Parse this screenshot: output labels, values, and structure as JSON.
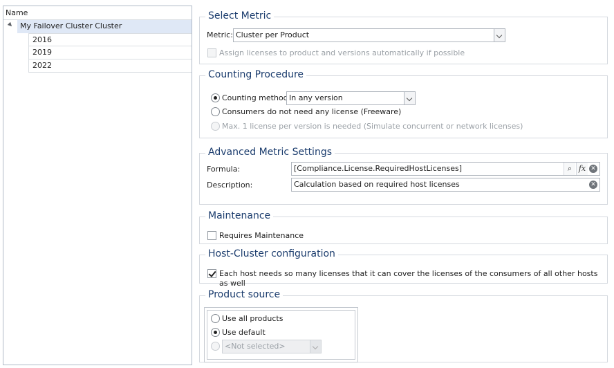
{
  "tree": {
    "header": "Name",
    "root": "My Failover Cluster Cluster",
    "children": [
      "2016",
      "2019",
      "2022"
    ]
  },
  "select_metric": {
    "title": "Select Metric",
    "metric_label": "Metric:",
    "metric_value": "Cluster per Product",
    "assign_label": "Assign licenses to product and versions automatically if possible"
  },
  "counting": {
    "title": "Counting Procedure",
    "method_label": "Counting method",
    "method_value": "In any version",
    "freeware_label": "Consumers do not need any license (Freeware)",
    "max_label": "Max. 1 license per version is needed (Simulate concurrent or network licenses)"
  },
  "advanced": {
    "title": "Advanced Metric Settings",
    "formula_label": "Formula:",
    "formula_value": "[Compliance.License.RequiredHostLicenses]",
    "description_label": "Description:",
    "description_value": "Calculation based on required host licenses",
    "fx_label": "fx"
  },
  "maintenance": {
    "title": "Maintenance",
    "requires_label": "Requires Maintenance"
  },
  "host_cluster": {
    "title": "Host-Cluster configuration",
    "each_host_label": "Each host needs so many licenses that it can cover the licenses of the consumers of all other hosts as well"
  },
  "product_source": {
    "title": "Product source",
    "all_label": "Use all products",
    "default_label": "Use default",
    "select_value": "<Not selected>"
  },
  "icons": {
    "search": "search-icon",
    "function": "function-icon",
    "clear": "clear-icon"
  }
}
